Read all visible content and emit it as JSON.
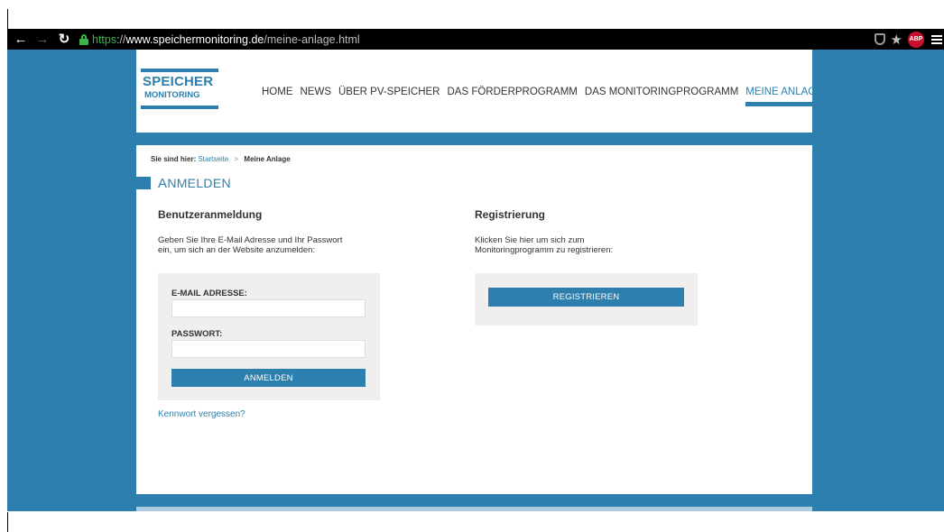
{
  "browser": {
    "url_https": "https",
    "url_sep": "://",
    "url_host": "www.speichermonitoring.de",
    "url_path": "/meine-anlage.html",
    "abp_label": "ABP"
  },
  "logo": {
    "line1": "SPEICHER",
    "line2": "MONITORING"
  },
  "nav": {
    "items": [
      {
        "label": "HOME"
      },
      {
        "label": "NEWS"
      },
      {
        "label": "ÜBER PV-SPEICHER"
      },
      {
        "label": "DAS FÖRDERPROGRAMM"
      },
      {
        "label": "DAS MONITORINGPROGRAMM"
      },
      {
        "label": "MEINE ANLAGE"
      }
    ],
    "active": "MEINE ANLAGE"
  },
  "breadcrumb": {
    "label": "Sie sind hier:",
    "home": "Startseite",
    "separator": ">",
    "current": "Meine Anlage"
  },
  "heading": {
    "first": "A",
    "rest": "NMELDEN"
  },
  "login": {
    "title": "Benutzeranmeldung",
    "description_1": "Geben Sie Ihre E-Mail Adresse und Ihr Passwort",
    "description_2": "ein, um sich an der Website anzumelden:",
    "email_label": "E-MAIL ADRESSE:",
    "password_label": "PASSWORT:",
    "button_label": "ANMELDEN",
    "forgot_label": "Kennwort vergessen?"
  },
  "register": {
    "title": "Registrierung",
    "description_1": "Klicken Sie hier um sich zum",
    "description_2": "Monitoringprogramm zu registrieren:",
    "button_label": "REGISTRIEREN"
  },
  "colors": {
    "brand": "#2d7fad",
    "panel": "#f0efed"
  }
}
